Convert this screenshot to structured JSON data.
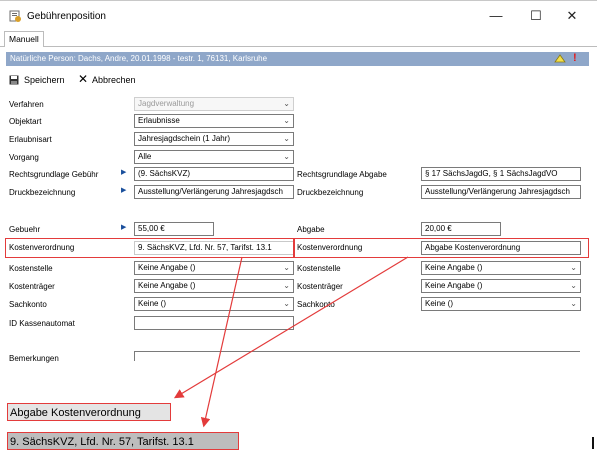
{
  "window": {
    "title": "Gebührenposition",
    "minimize_glyph": "—",
    "maximize_glyph": "☐",
    "close_glyph": "✕"
  },
  "tabs": [
    {
      "label": "Manuell"
    }
  ],
  "person_bar": {
    "text": "Natürliche Person: Dachs, Andre, 20.01.1998 - testr. 1, 76131, Karlsruhe"
  },
  "toolbar": {
    "save_label": "Speichern",
    "cancel_label": "Abbrechen"
  },
  "form_left": {
    "verfahren": {
      "label": "Verfahren",
      "value": "Jagdverwaltung"
    },
    "objektart": {
      "label": "Objektart",
      "value": "Erlaubnisse"
    },
    "erlaubnisart": {
      "label": "Erlaubnisart",
      "value": "Jahresjagdschein (1 Jahr)"
    },
    "vorgang": {
      "label": "Vorgang",
      "value": "Alle"
    },
    "rechtsgrundlage": {
      "label": "Rechtsgrundlage Gebühr",
      "value": "(9. SächsKVZ)"
    },
    "druck": {
      "label": "Druckbezeichnung",
      "value": "Ausstellung/Verlängerung Jahresjagdsch"
    },
    "gebuehr": {
      "label": "Gebuehr",
      "value": "55,00 €"
    },
    "kostenverordnung": {
      "label": "Kostenverordnung",
      "value": "9. SächsKVZ, Lfd. Nr. 57, Tarifst. 13.1"
    },
    "kostenstelle": {
      "label": "Kostenstelle",
      "value": "Keine Angabe ()"
    },
    "kostentraeger": {
      "label": "Kostenträger",
      "value": "Keine Angabe ()"
    },
    "sachkonto": {
      "label": "Sachkonto",
      "value": "Keine ()"
    },
    "id_kassenautomat": {
      "label": "ID Kassenautomat",
      "value": ""
    },
    "bemerkungen": {
      "label": "Bemerkungen",
      "value": ""
    }
  },
  "form_right": {
    "rechtsgrundlage": {
      "label": "Rechtsgrundlage Abgabe",
      "value": "§ 17 SächsJagdG, § 1 SächsJagdVO"
    },
    "druck": {
      "label": "Druckbezeichnung",
      "value": "Ausstellung/Verlängerung Jahresjagdsch"
    },
    "abgabe": {
      "label": "Abgabe",
      "value": "20,00 €"
    },
    "kostenverordnung": {
      "label": "Kostenverordnung",
      "value": "Abgabe Kostenverordnung"
    },
    "kostenstelle": {
      "label": "Kostenstelle",
      "value": "Keine Angabe ()"
    },
    "kostentraeger": {
      "label": "Kostenträger",
      "value": "Keine Angabe ()"
    },
    "sachkonto": {
      "label": "Sachkonto",
      "value": "Keine ()"
    }
  },
  "callouts": {
    "abgabe": "Abgabe Kostenverordnung",
    "gebuehr": "9. SächsKVZ, Lfd. Nr. 57, Tarifst. 13.1"
  },
  "colors": {
    "accent_red": "#e33b3b",
    "person_bar_bg": "#8fa7c9",
    "arrow_blue": "#1a4f9c"
  }
}
